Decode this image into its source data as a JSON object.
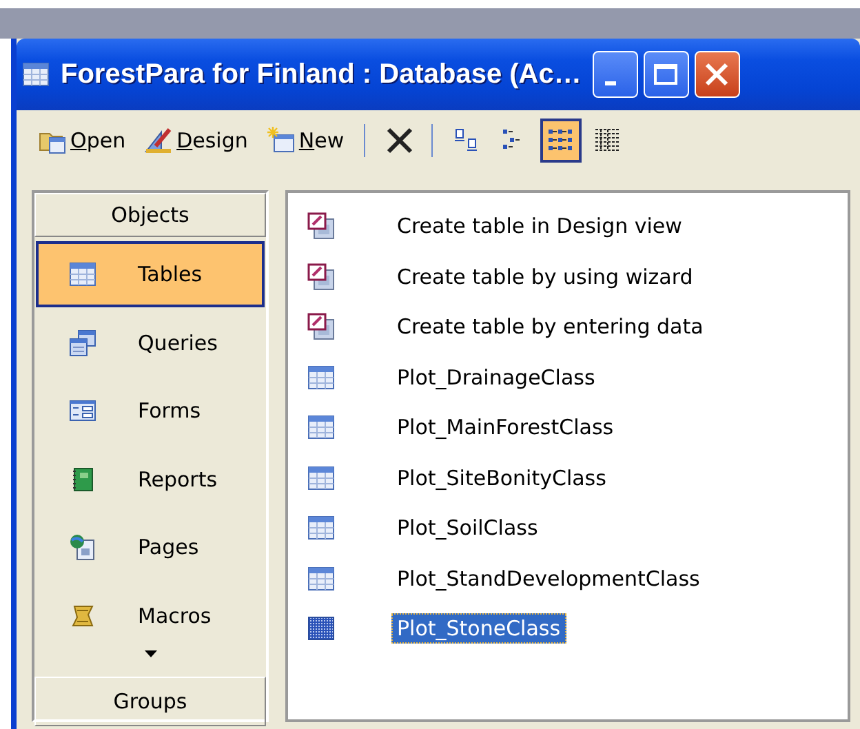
{
  "window": {
    "title": "ForestPara for Finland : Database (Ac…"
  },
  "toolbar": {
    "buttons": [
      {
        "kind": "command",
        "label": "Open"
      },
      {
        "kind": "command",
        "label": "Design"
      },
      {
        "kind": "command",
        "label": "New"
      },
      {
        "kind": "separator"
      },
      {
        "kind": "delete"
      },
      {
        "kind": "separator"
      },
      {
        "kind": "view",
        "selected": false
      },
      {
        "kind": "view",
        "selected": false
      },
      {
        "kind": "view",
        "selected": true
      },
      {
        "kind": "view",
        "selected": false
      }
    ]
  },
  "sidebar": {
    "header": "Objects",
    "items": [
      {
        "label": "Tables",
        "selected": true
      },
      {
        "label": "Queries",
        "selected": false
      },
      {
        "label": "Forms",
        "selected": false
      },
      {
        "label": "Reports",
        "selected": false
      },
      {
        "label": "Pages",
        "selected": false
      },
      {
        "label": "Macros",
        "selected": false
      }
    ],
    "footer": "Groups"
  },
  "list": {
    "items": [
      {
        "kind": "wizard",
        "label": "Create table in Design view",
        "selected": false
      },
      {
        "kind": "wizard",
        "label": "Create table by using wizard",
        "selected": false
      },
      {
        "kind": "wizard",
        "label": "Create table by entering data",
        "selected": false
      },
      {
        "kind": "table",
        "label": "Plot_DrainageClass",
        "selected": false
      },
      {
        "kind": "table",
        "label": "Plot_MainForestClass",
        "selected": false
      },
      {
        "kind": "table",
        "label": "Plot_SiteBonityClass",
        "selected": false
      },
      {
        "kind": "table",
        "label": "Plot_SoilClass",
        "selected": false
      },
      {
        "kind": "table",
        "label": "Plot_StandDevelopmentClass",
        "selected": false
      },
      {
        "kind": "table",
        "label": "Plot_StoneClass",
        "selected": true
      }
    ]
  }
}
